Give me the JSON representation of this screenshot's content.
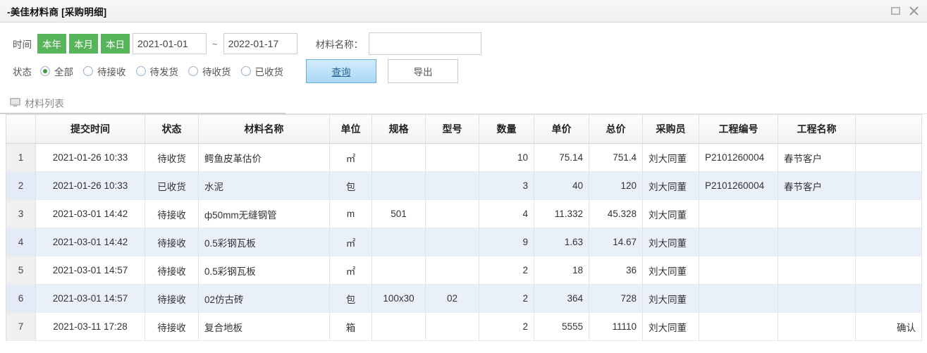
{
  "window": {
    "title": "-美佳材料商 [采购明细]",
    "maximize_icon": "maximize-icon",
    "close_icon": "close-icon"
  },
  "filters": {
    "time_label": "时间",
    "quick_ranges": [
      {
        "label": "本年",
        "name": "this-year"
      },
      {
        "label": "本月",
        "name": "this-month"
      },
      {
        "label": "本日",
        "name": "this-day"
      }
    ],
    "date_from": "2021-01-01",
    "date_to": "2022-01-17",
    "date_separator": "~",
    "material_label": "材料名称：",
    "material_value": "",
    "material_placeholder": "",
    "status_label": "状态",
    "status_options": [
      {
        "label": "全部",
        "checked": true
      },
      {
        "label": "待接收",
        "checked": false
      },
      {
        "label": "待发货",
        "checked": false
      },
      {
        "label": "待收货",
        "checked": false
      },
      {
        "label": "已收货",
        "checked": false
      }
    ],
    "query_label": "查询",
    "export_label": "导出",
    "accent_green": "#57b45b",
    "accent_blue": "#2a6496"
  },
  "tab": {
    "icon": "monitor-icon",
    "label": "材料列表"
  },
  "table": {
    "columns": [
      "",
      "提交时间",
      "状态",
      "材料名称",
      "单位",
      "规格",
      "型号",
      "数量",
      "单价",
      "总价",
      "采购员",
      "工程编号",
      "工程名称",
      ""
    ],
    "rows": [
      {
        "no": "1",
        "time": "2021-01-26 10:33",
        "status": "待收货",
        "material": "鳄鱼皮革估价",
        "unit": "㎡",
        "spec": "",
        "model": "",
        "qty": "10",
        "price": "75.14",
        "total": "751.4",
        "buyer": "刘大同董",
        "proj_no": "P2101260004",
        "proj_name": "春节客户",
        "action": ""
      },
      {
        "no": "2",
        "time": "2021-01-26 10:33",
        "status": "已收货",
        "material": "水泥",
        "unit": "包",
        "spec": "",
        "model": "",
        "qty": "3",
        "price": "40",
        "total": "120",
        "buyer": "刘大同董",
        "proj_no": "P2101260004",
        "proj_name": "春节客户",
        "action": ""
      },
      {
        "no": "3",
        "time": "2021-03-01 14:42",
        "status": "待接收",
        "material": "ф50mm无缝钢管",
        "unit": "m",
        "spec": "501",
        "model": "",
        "qty": "4",
        "price": "11.332",
        "total": "45.328",
        "buyer": "刘大同董",
        "proj_no": "",
        "proj_name": "",
        "action": ""
      },
      {
        "no": "4",
        "time": "2021-03-01 14:42",
        "status": "待接收",
        "material": "0.5彩钢瓦板",
        "unit": "㎡",
        "spec": "",
        "model": "",
        "qty": "9",
        "price": "1.63",
        "total": "14.67",
        "buyer": "刘大同董",
        "proj_no": "",
        "proj_name": "",
        "action": ""
      },
      {
        "no": "5",
        "time": "2021-03-01 14:57",
        "status": "待接收",
        "material": "0.5彩钢瓦板",
        "unit": "㎡",
        "spec": "",
        "model": "",
        "qty": "2",
        "price": "18",
        "total": "36",
        "buyer": "刘大同董",
        "proj_no": "",
        "proj_name": "",
        "action": ""
      },
      {
        "no": "6",
        "time": "2021-03-01 14:57",
        "status": "待接收",
        "material": "02仿古砖",
        "unit": "包",
        "spec": "100x30",
        "model": "02",
        "qty": "2",
        "price": "364",
        "total": "728",
        "buyer": "刘大同董",
        "proj_no": "",
        "proj_name": "",
        "action": ""
      },
      {
        "no": "7",
        "time": "2021-03-11 17:28",
        "status": "待接收",
        "material": "复合地板",
        "unit": "箱",
        "spec": "",
        "model": "",
        "qty": "2",
        "price": "5555",
        "total": "11110",
        "buyer": "刘大同董",
        "proj_no": "",
        "proj_name": "",
        "action": "确认"
      }
    ]
  }
}
